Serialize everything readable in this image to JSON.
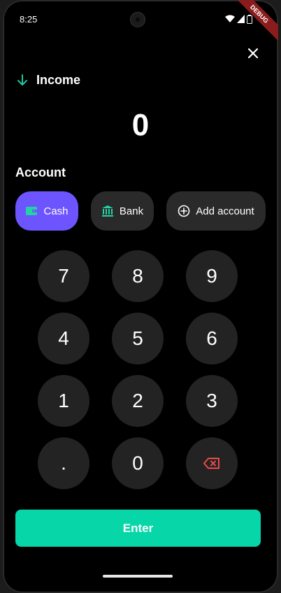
{
  "status": {
    "time": "8:25",
    "debug_label": "DEBUG"
  },
  "header": {
    "title": "Income",
    "icon": "arrow-down-icon",
    "accent": "#1ec8a0"
  },
  "amount": "0",
  "account": {
    "section_title": "Account",
    "options": [
      {
        "label": "Cash",
        "icon": "wallet-icon",
        "selected": true
      },
      {
        "label": "Bank",
        "icon": "bank-icon",
        "selected": false
      },
      {
        "label": "Add account",
        "icon": "add-circle-icon",
        "selected": false
      }
    ]
  },
  "keypad": {
    "keys": [
      "7",
      "8",
      "9",
      "4",
      "5",
      "6",
      "1",
      "2",
      "3",
      ".",
      "0"
    ],
    "backspace_icon": "backspace-icon"
  },
  "enter_label": "Enter",
  "colors": {
    "primary": "#6c55ff",
    "accent": "#06d6a8",
    "danger": "#e84a4a",
    "key_bg": "#232323",
    "chip_bg": "#2a2a2a"
  }
}
